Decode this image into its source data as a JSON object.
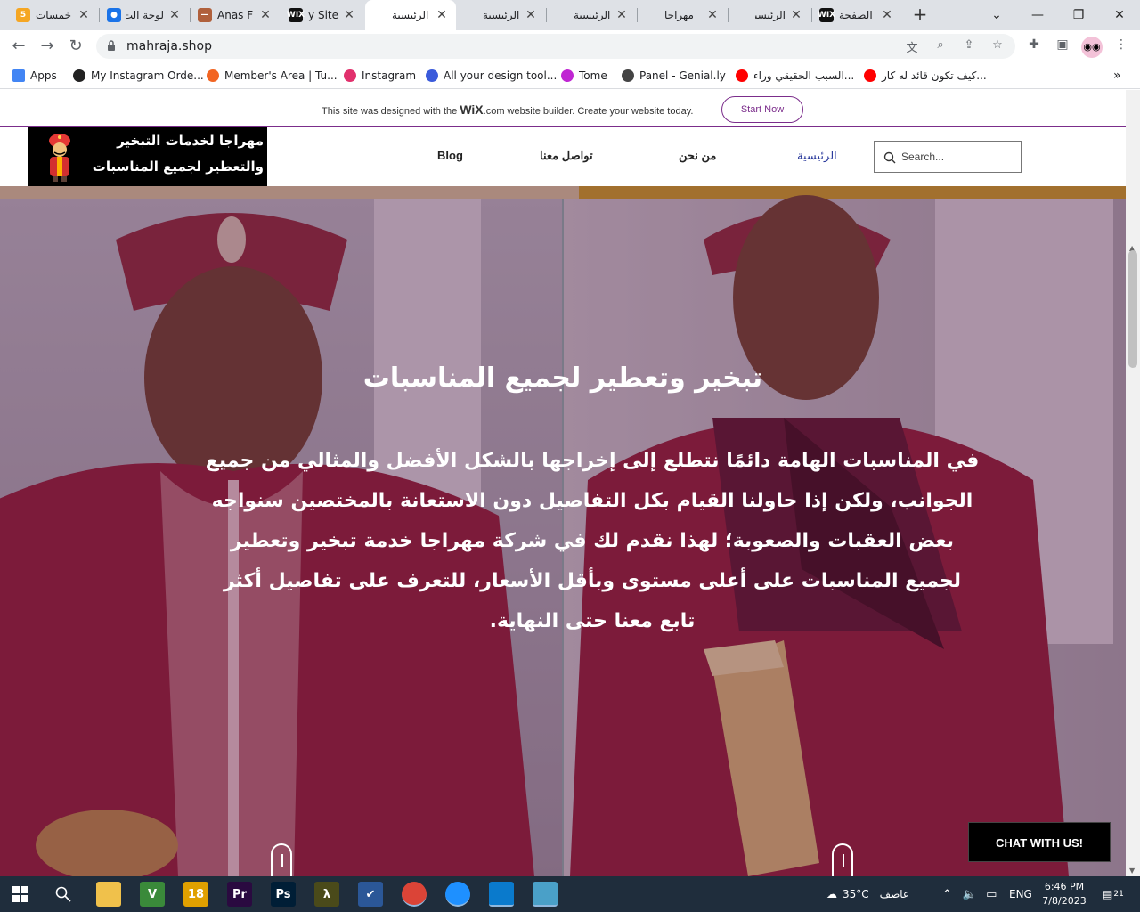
{
  "browser": {
    "tabs": [
      {
        "title": "خمسات",
        "badge": "5",
        "color": "#f5a623"
      },
      {
        "title": "لوحة الت",
        "badge": "●",
        "color": "#1a73e8"
      },
      {
        "title": "Anas F",
        "badge": "—",
        "color": "#b0603c"
      },
      {
        "title": "My Site",
        "badge": "WIX",
        "color": "#111111"
      },
      {
        "title": "الرئيسية",
        "badge": "",
        "color": "#ffffff"
      },
      {
        "title": "الرئيسية",
        "badge": "",
        "color": "#dee1e6"
      },
      {
        "title": "الرئيسية",
        "badge": "",
        "color": "#dee1e6"
      },
      {
        "title": "مهراجا",
        "badge": "",
        "color": "#dee1e6"
      },
      {
        "title": "الرئيسية",
        "badge": "",
        "color": "#dee1e6"
      },
      {
        "title": "الصفحة",
        "badge": "WIX",
        "color": "#111111"
      }
    ],
    "url": "mahraja.shop",
    "bookmarks": [
      {
        "label": "Apps",
        "color": "#4285f4"
      },
      {
        "label": "My Instagram Orde...",
        "color": "#222222"
      },
      {
        "label": "Member's Area | Tu...",
        "color": "#f26522"
      },
      {
        "label": "Instagram",
        "color": "#e1306c"
      },
      {
        "label": "All your design tool...",
        "color": "#3b5bdb"
      },
      {
        "label": "Tome",
        "color": "#c026d3"
      },
      {
        "label": "Panel - Genial.ly",
        "color": "#444444"
      },
      {
        "label": "السبب الحقيقي وراء...",
        "color": "#ff0000"
      },
      {
        "label": "كيف تكون قائد له كار...",
        "color": "#ff0000"
      }
    ],
    "more_bookmarks": "»"
  },
  "wix_banner": {
    "prefix": "This site was designed with the",
    "brand": "WiX",
    "suffix": ".com website builder. Create your website today.",
    "cta": "Start Now"
  },
  "site": {
    "logo_line1": "مهراجا لخدمات التبخير",
    "logo_line2": "والتعطير لجميع المناسبات",
    "nav": {
      "blog": "Blog",
      "contact": "تواصل معنا",
      "about": "من نحن",
      "home": "الرئيسية"
    },
    "search_placeholder": "Search...",
    "hero_title": "تبخير وتعطير لجميع المناسبات",
    "hero_body": "في المناسبات الهامة دائمًا نتطلع إلى إخراجها بالشكل الأفضل والمثالي من جميع الجوانب، ولكن إذا حاولنا القيام بكل التفاصيل دون الاستعانة بالمختصين سنواجه بعض العقبات والصعوبة؛ لهذا نقدم لك في شركة مهراجا خدمة تبخير وتعطير لجميع المناسبات على أعلى مستوى وبأقل الأسعار، للتعرف على تفاصيل أكثر تابع معنا حتى النهاية.",
    "chat_button": "CHAT WITH US!"
  },
  "taskbar": {
    "weather": "35°C",
    "weather_desc": "عاصف",
    "language": "ENG",
    "time": "6:46 PM",
    "date": "7/8/2023",
    "notifications": "21",
    "apps": [
      {
        "name": "file-explorer",
        "label": "",
        "color": "#f0c14b"
      },
      {
        "name": "vim",
        "label": "V",
        "color": "#3a8a3a"
      },
      {
        "name": "app-18",
        "label": "18",
        "color": "#e0a000"
      },
      {
        "name": "premiere",
        "label": "Pr",
        "color": "#2a0a40"
      },
      {
        "name": "photoshop",
        "label": "Ps",
        "color": "#001e36"
      },
      {
        "name": "lambda",
        "label": "λ",
        "color": "#4a4a1a"
      },
      {
        "name": "todo",
        "label": "✔",
        "color": "#2b5797"
      },
      {
        "name": "chrome",
        "label": "",
        "color": "#db4437"
      },
      {
        "name": "browser-2",
        "label": "",
        "color": "#1e90ff"
      },
      {
        "name": "vscode",
        "label": "",
        "color": "#0a7acc"
      },
      {
        "name": "notes",
        "label": "",
        "color": "#4aa0c8"
      }
    ]
  }
}
